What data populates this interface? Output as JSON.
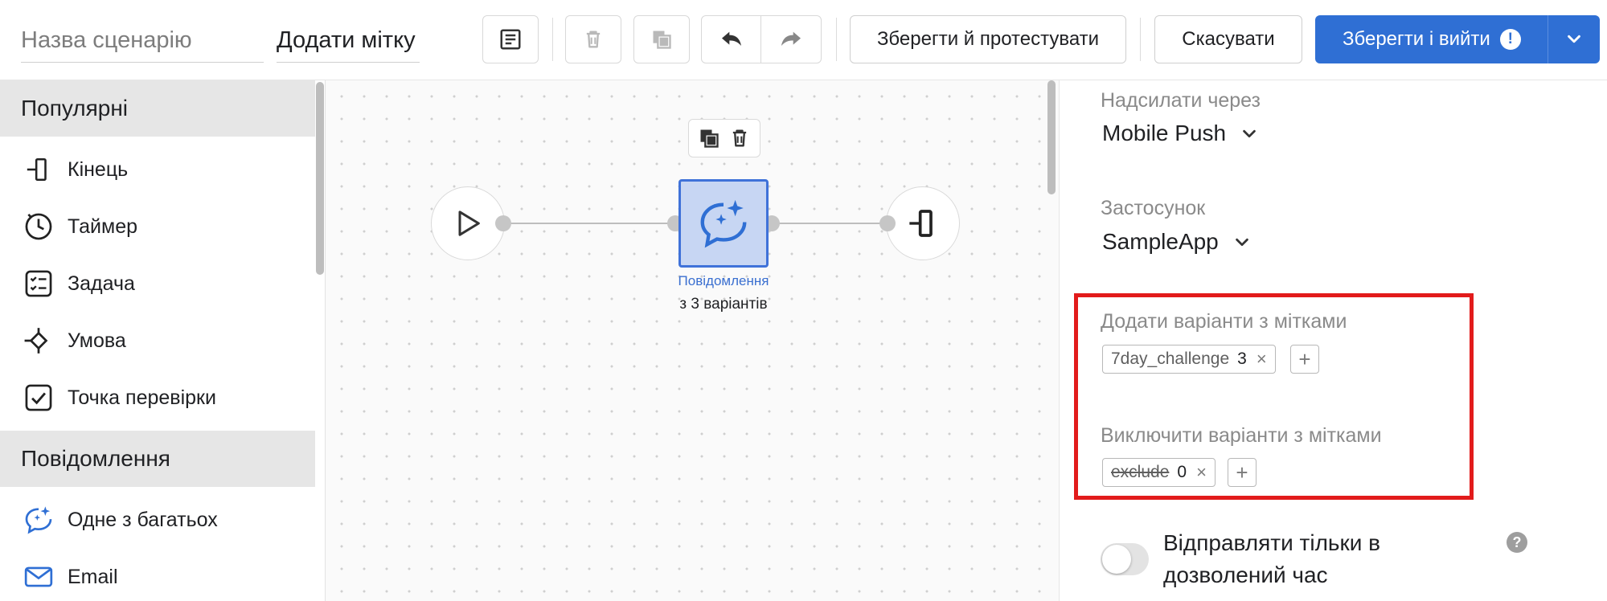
{
  "header": {
    "scenario_name_placeholder": "Назва сценарію",
    "tag_value": "Додати мітку",
    "save_test_label": "Зберегти й протестувати",
    "cancel_label": "Скасувати",
    "save_exit_label": "Зберегти і вийти",
    "save_exit_alert": "!",
    "icons": [
      "notes-icon",
      "trash-icon",
      "copy-icon",
      "undo-icon",
      "redo-icon",
      "chevron-down-icon"
    ]
  },
  "sidebar": {
    "popular_title": "Популярні",
    "popular_items": [
      {
        "label": "Кінець",
        "icon": "end-icon"
      },
      {
        "label": "Таймер",
        "icon": "timer-icon"
      },
      {
        "label": "Задача",
        "icon": "task-icon"
      },
      {
        "label": "Умова",
        "icon": "condition-icon"
      },
      {
        "label": "Точка перевірки",
        "icon": "checkpoint-icon"
      }
    ],
    "messages_title": "Повідомлення",
    "message_items": [
      {
        "label": "Одне з багатьох",
        "icon": "one-of-many-icon"
      },
      {
        "label": "Email",
        "icon": "email-icon"
      }
    ]
  },
  "canvas": {
    "message_node_title": "Повідомлення",
    "message_node_subtitle": "з 3 варіантів"
  },
  "settings": {
    "send_via_label": "Надсилати через",
    "send_via_value": "Mobile Push",
    "app_label": "Застосунок",
    "app_value": "SampleApp",
    "include_label": "Додати варіанти з мітками",
    "include_tags": [
      {
        "name": "7day_challenge",
        "count": "3"
      }
    ],
    "exclude_label": "Виключити варіанти з мітками",
    "exclude_tags": [
      {
        "name": "exclude",
        "count": "0"
      }
    ],
    "remove_glyph": "×",
    "add_glyph": "+",
    "allowed_time_label": "Відправляти тільки в дозволений час",
    "allowed_time_enabled": false,
    "help_glyph": "?"
  },
  "colors": {
    "primary": "#2f6fd4",
    "node_fill": "#c7d6f3",
    "node_border": "#3f72d9",
    "highlight_border": "#e21b1b"
  }
}
